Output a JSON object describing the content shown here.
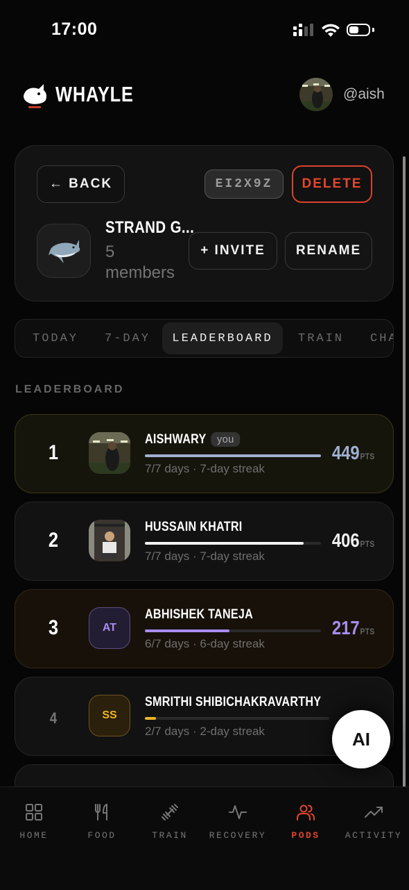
{
  "status_bar": {
    "time": "17:00"
  },
  "header": {
    "brand": "WHAYLE",
    "handle": "@aish"
  },
  "pod": {
    "back_label": "← BACK",
    "code": "EI2X9Z",
    "delete_label": "DELETE",
    "name": "STRAND G...",
    "members": "5 members",
    "invite_label": "+ INVITE",
    "rename_label": "RENAME"
  },
  "tabs": [
    {
      "label": "TODAY"
    },
    {
      "label": "7-DAY"
    },
    {
      "label": "LEADERBOARD",
      "active": true
    },
    {
      "label": "TRAIN"
    },
    {
      "label": "CHA"
    }
  ],
  "section_label": "LEADERBOARD",
  "leaderboard": [
    {
      "rank": "1",
      "name": "AISHWARY",
      "badge": "you",
      "subtitle": "7/7 days · 7-day streak",
      "score": "449",
      "unit": "PTS",
      "progress": 1.0,
      "color": "#9fb0d2"
    },
    {
      "rank": "2",
      "name": "HUSSAIN KHATRI",
      "subtitle": "7/7 days · 7-day streak",
      "score": "406",
      "unit": "PTS",
      "progress": 0.9,
      "color": "#f2f2f2"
    },
    {
      "rank": "3",
      "name": "ABHISHEK TANEJA",
      "initials": "AT",
      "subtitle": "6/7 days · 6-day streak",
      "score": "217",
      "unit": "PTS",
      "progress": 0.48,
      "color": "#a98cf0"
    },
    {
      "rank": "4",
      "name": "SMRITHI SHIBICHAKRAVARTHY",
      "initials": "SS",
      "subtitle": "2/7 days · 2-day streak",
      "score": "",
      "unit": "",
      "progress": 0.06,
      "color": "#f0b429"
    }
  ],
  "ai_fab": "AI",
  "bottom_nav": [
    {
      "label": "HOME",
      "icon": "grid-icon"
    },
    {
      "label": "FOOD",
      "icon": "utensils-icon"
    },
    {
      "label": "TRAIN",
      "icon": "dumbbell-icon"
    },
    {
      "label": "RECOVERY",
      "icon": "pulse-icon"
    },
    {
      "label": "PODS",
      "icon": "users-icon",
      "active": true
    },
    {
      "label": "ACTIVITY",
      "icon": "trending-icon"
    }
  ],
  "colors": {
    "accent": "#e2452c",
    "background": "#060606"
  }
}
